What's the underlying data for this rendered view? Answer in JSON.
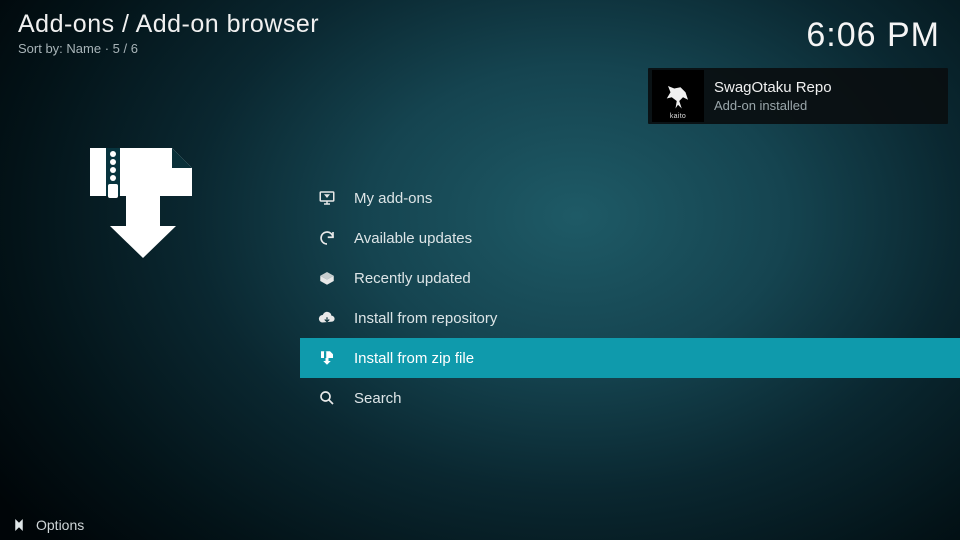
{
  "header": {
    "breadcrumb": "Add-ons / Add-on browser",
    "sort_label": "Sort by: Name",
    "position": "5 / 6"
  },
  "clock": "6:06 PM",
  "notification": {
    "title": "SwagOtaku Repo",
    "subtitle": "Add-on installed",
    "icon_caption": "kaito"
  },
  "menu": {
    "items": [
      {
        "icon": "monitor-icon",
        "label": "My add-ons",
        "selected": false
      },
      {
        "icon": "refresh-icon",
        "label": "Available updates",
        "selected": false
      },
      {
        "icon": "openbox-icon",
        "label": "Recently updated",
        "selected": false
      },
      {
        "icon": "cloud-download-icon",
        "label": "Install from repository",
        "selected": false
      },
      {
        "icon": "zip-icon",
        "label": "Install from zip file",
        "selected": true
      },
      {
        "icon": "search-icon",
        "label": "Search",
        "selected": false
      }
    ]
  },
  "footer": {
    "options_label": "Options"
  }
}
